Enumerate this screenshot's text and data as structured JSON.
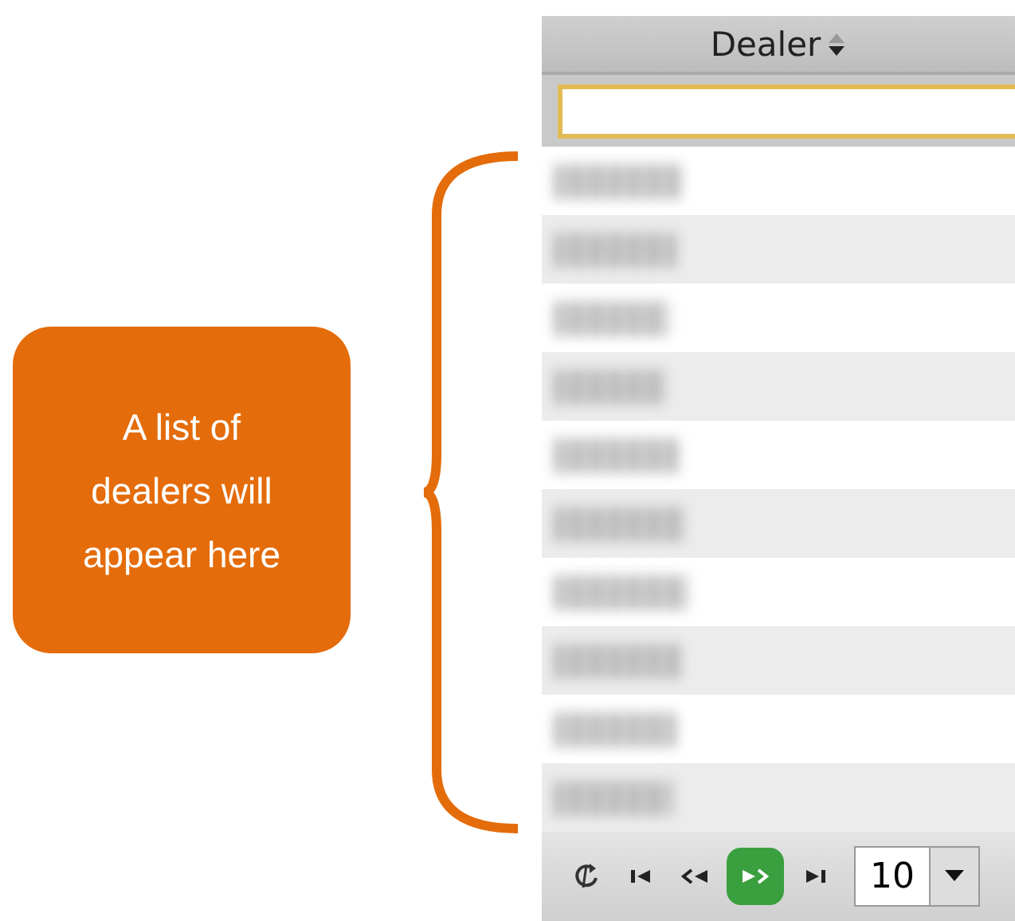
{
  "callout": {
    "text": "A list of dealers will appear here"
  },
  "table": {
    "column": {
      "header": "Dealer",
      "sort_descending": true
    },
    "filter": {
      "focused": true
    },
    "rows": [
      {
        "kind": "blurred"
      },
      {
        "kind": "blurred"
      },
      {
        "kind": "blurred"
      },
      {
        "kind": "blurred"
      },
      {
        "kind": "blurred"
      },
      {
        "kind": "blurred"
      },
      {
        "kind": "blurred"
      },
      {
        "kind": "blurred"
      },
      {
        "kind": "blurred"
      },
      {
        "kind": "blurred"
      }
    ],
    "pager": {
      "buttons": [
        {
          "kind": "refresh",
          "highlighted": false
        },
        {
          "kind": "first",
          "highlighted": false
        },
        {
          "kind": "prev",
          "highlighted": false
        },
        {
          "kind": "next",
          "highlighted": true
        },
        {
          "kind": "last",
          "highlighted": false
        }
      ],
      "page_size": "10"
    }
  }
}
